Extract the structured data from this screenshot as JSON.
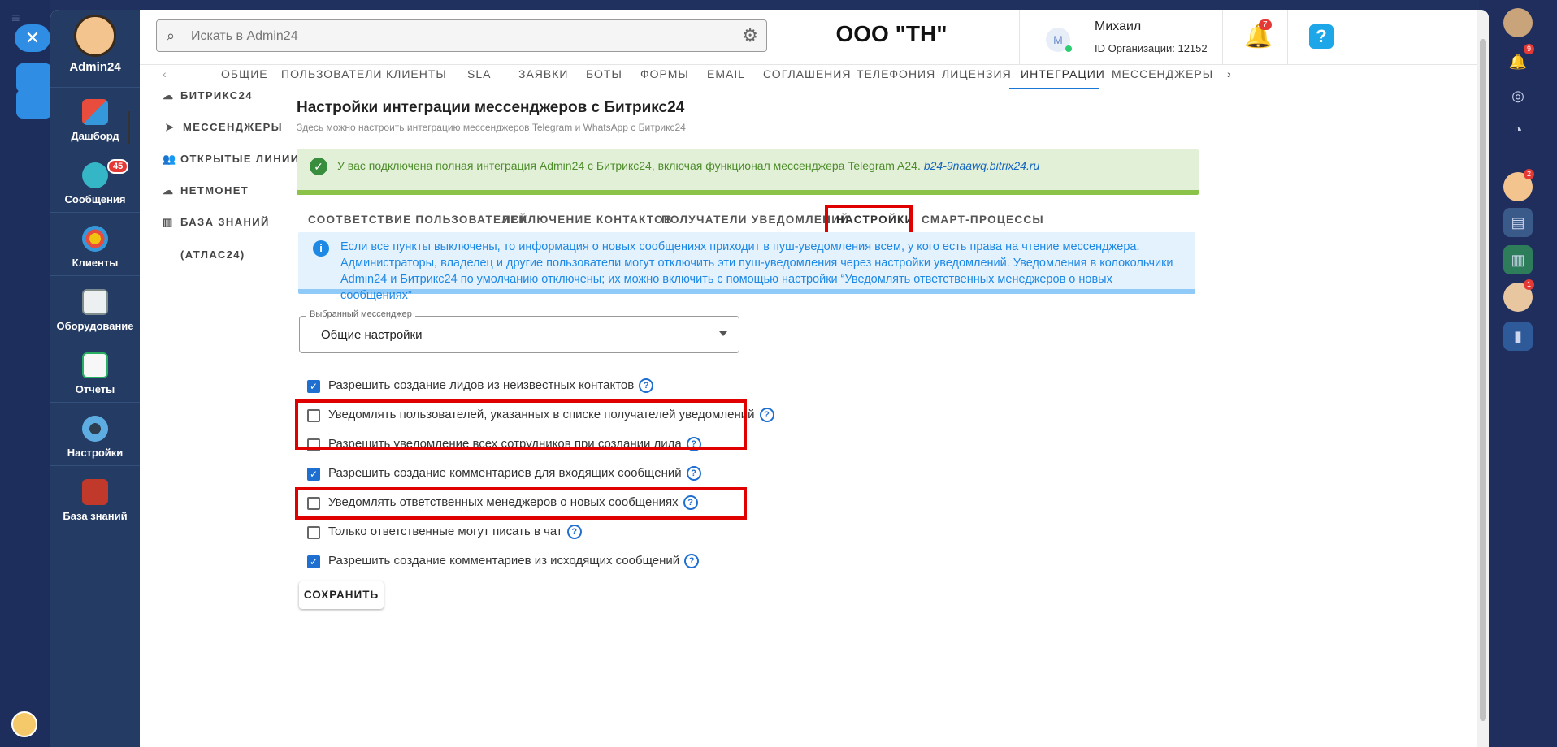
{
  "app": {
    "logo_label": "Admin24",
    "org_name": "ООО \"ТН\""
  },
  "search": {
    "placeholder": "Искать в Admin24"
  },
  "user": {
    "initial": "М",
    "name": "Михаил",
    "org_id": "ID Организации: 12152"
  },
  "notifications": {
    "count": "7"
  },
  "help": {
    "label": "?"
  },
  "nav": [
    {
      "label": "Дашборд"
    },
    {
      "label": "Сообщения",
      "badge": "45"
    },
    {
      "label": "Клиенты"
    },
    {
      "label": "Оборудование"
    },
    {
      "label": "Отчеты"
    },
    {
      "label": "Настройки"
    },
    {
      "label": "База знаний"
    }
  ],
  "top_tabs": [
    "ОБЩИЕ",
    "ПОЛЬЗОВАТЕЛИ",
    "КЛИЕНТЫ",
    "SLA",
    "ЗАЯВКИ",
    "БОТЫ",
    "ФОРМЫ",
    "EMAIL",
    "СОГЛАШЕНИЯ",
    "ТЕЛЕФОНИЯ",
    "ЛИЦЕНЗИЯ",
    "ИНТЕГРАЦИИ",
    "МЕССЕНДЖЕРЫ"
  ],
  "top_tabs_active": "ИНТЕГРАЦИИ",
  "sub_menu": [
    "БИТРИКС24",
    "МЕССЕНДЖЕРЫ",
    "ОТКРЫТЫЕ ЛИНИИ",
    "НЕТМОНЕТ",
    "БАЗА ЗНАНИЙ (АТЛАС24)"
  ],
  "sub_menu_active": "МЕССЕНДЖЕРЫ",
  "page": {
    "title": "Настройки интеграции мессенджеров с Битрикс24",
    "subtitle": "Здесь можно настроить интеграцию мессенджеров Telegram и WhatsApp с Битрикс24"
  },
  "success": {
    "text": "У вас подключена полная интеграция Admin24 с Битрикс24, включая функционал мессенджера Telegram A24.",
    "link": "b24-9naawq.bitrix24.ru"
  },
  "settings_tabs": [
    "СООТВЕТСТВИЕ ПОЛЬЗОВАТЕЛЕЙ",
    "ИСКЛЮЧЕНИЕ КОНТАКТОВ",
    "ПОЛУЧАТЕЛИ УВЕДОМЛЕНИЙ",
    "НАСТРОЙКИ",
    "СМАРТ-ПРОЦЕССЫ"
  ],
  "settings_tabs_active": "НАСТРОЙКИ",
  "info": {
    "text": "Если все пункты выключены, то информация о новых сообщениях приходит в пуш-уведомления всем, у кого есть права на чтение мессенджера. Администраторы, владелец и другие пользователи могут отключить эти пуш-уведомления через настройки уведомлений. Уведомления в колокольчики Admin24 и Битрикс24 по умолчанию отключены; их можно включить с помощью настройки “Уведомлять ответственных менеджеров о новых сообщениях”"
  },
  "messenger_select": {
    "label": "Выбранный мессенджер",
    "value": "Общие настройки"
  },
  "options": [
    {
      "label": "Разрешить создание лидов из неизвестных контактов",
      "checked": true
    },
    {
      "label": "Уведомлять пользователей, указанных в списке получателей уведомлений",
      "checked": false
    },
    {
      "label": "Разрешить уведомление всех сотрудников при создании лида",
      "checked": false
    },
    {
      "label": "Разрешить создание комментариев для входящих сообщений",
      "checked": true
    },
    {
      "label": "Уведомлять ответственных менеджеров о новых сообщениях",
      "checked": false
    },
    {
      "label": "Только ответственные могут писать в чат",
      "checked": false
    },
    {
      "label": "Разрешить создание комментариев из исходящих сообщений",
      "checked": true
    }
  ],
  "save_label": "СОХРАНИТЬ",
  "right_rail": {
    "badges": [
      "9",
      "2",
      "1"
    ]
  },
  "colors": {
    "accent": "#1976d2",
    "nav_bg": "#243b63",
    "highlight": "#e00000",
    "success_bg": "#e3f0d8",
    "info_bg": "#e3f2fd"
  }
}
